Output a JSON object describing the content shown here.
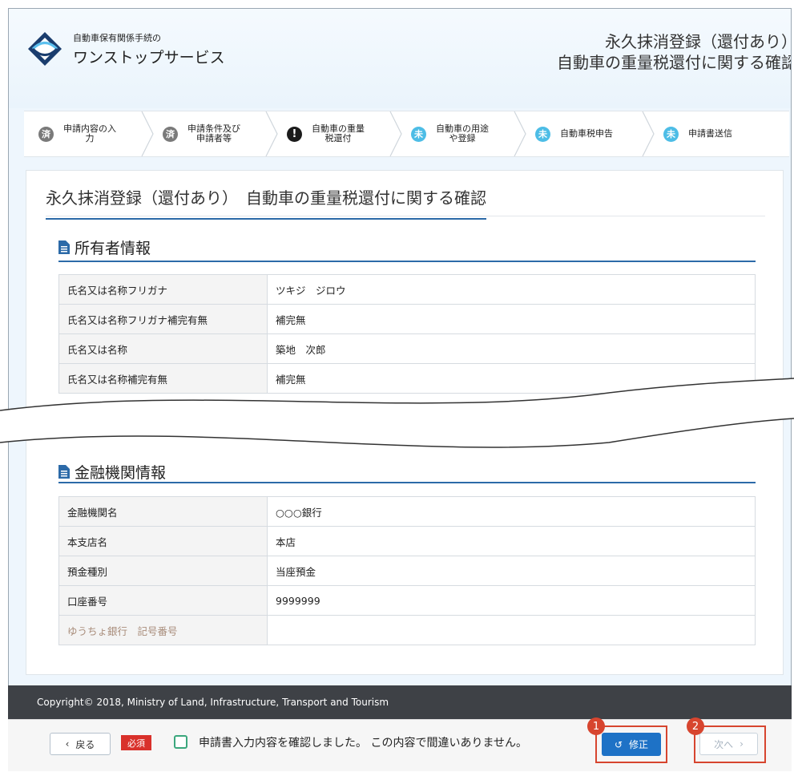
{
  "header": {
    "service_small": "自動車保有関係手続の",
    "service_main": "ワンストップサービス",
    "title_line1": "永久抹消登録（還付あり）",
    "title_line2": "自動車の重量税還付に関する確認"
  },
  "steps": [
    {
      "badge": "済",
      "label1": "申請内容の入",
      "label2": "力"
    },
    {
      "badge": "済",
      "label1": "申請条件及び",
      "label2": "申請者等"
    },
    {
      "badge": "!",
      "label1": "自動車の重量",
      "label2": "税還付"
    },
    {
      "badge": "未",
      "label1": "自動車の用途",
      "label2": "や登録"
    },
    {
      "badge": "未",
      "label1": "自動車税申告",
      "label2": ""
    },
    {
      "badge": "未",
      "label1": "申請書送信",
      "label2": ""
    }
  ],
  "page_title": "永久抹消登録（還付あり）　自動車の重量税還付に関する確認",
  "owner_section": {
    "heading": "所有者情報",
    "rows": [
      {
        "k": "氏名又は名称フリガナ",
        "v": "ツキジ　ジロウ"
      },
      {
        "k": "氏名又は名称フリガナ補完有無",
        "v": "補完無"
      },
      {
        "k": "氏名又は名称",
        "v": "築地　次郎"
      },
      {
        "k": "氏名又は名称補完有無",
        "v": "補完無"
      }
    ]
  },
  "bank_section": {
    "heading": "金融機関情報",
    "rows": [
      {
        "k": "金融機関名",
        "v": "○○○銀行"
      },
      {
        "k": "本支店名",
        "v": "本店"
      },
      {
        "k": "預金種別",
        "v": "当座預金"
      },
      {
        "k": "口座番号",
        "v": "9999999"
      },
      {
        "k": "ゆうちょ銀行　記号番号",
        "v": ""
      }
    ]
  },
  "footer": {
    "copyright": "Copyright© 2018, Ministry of Land, Infrastructure, Transport and Tourism",
    "back_label": "戻る",
    "required_label": "必須",
    "confirm_text": "申請書入力内容を確認しました。 この内容で間違いありません。",
    "fix_label": "修正",
    "next_label": "次へ"
  },
  "markers": [
    "1",
    "2"
  ]
}
